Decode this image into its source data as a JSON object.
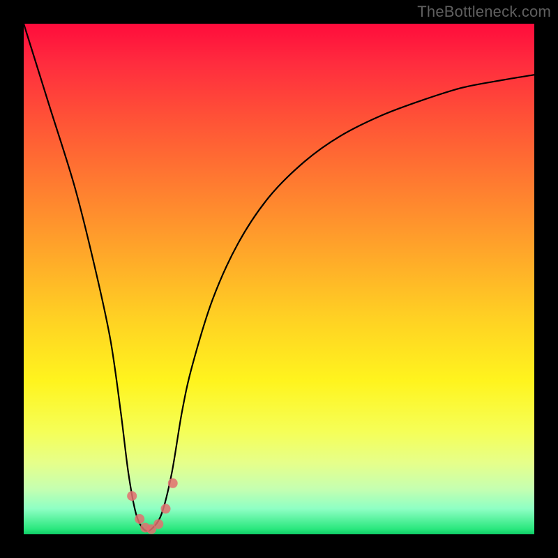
{
  "watermark": "TheBottleneck.com",
  "chart_data": {
    "type": "line",
    "title": "",
    "xlabel": "",
    "ylabel": "",
    "xlim": [
      0,
      100
    ],
    "ylim": [
      0,
      100
    ],
    "curve": {
      "x": [
        0,
        5,
        10,
        14,
        17,
        19,
        20.5,
        22,
        23.5,
        25,
        27,
        29,
        31,
        33,
        37,
        42,
        48,
        55,
        62,
        70,
        78,
        86,
        94,
        100
      ],
      "y": [
        100,
        84,
        68,
        52,
        38,
        24,
        12,
        4,
        1,
        1,
        4,
        12,
        24,
        33,
        46,
        57,
        66,
        73,
        78,
        82,
        85,
        87.5,
        89,
        90
      ]
    },
    "markers": {
      "x": [
        21.2,
        22.7,
        23.8,
        25.0,
        26.4,
        27.8,
        29.2
      ],
      "y": [
        7.5,
        3.0,
        1.3,
        1.0,
        2.0,
        5.0,
        10.0
      ]
    },
    "gradient_stops": [
      {
        "pct": 0,
        "color": "#ff0c3c"
      },
      {
        "pct": 8,
        "color": "#ff2d3e"
      },
      {
        "pct": 18,
        "color": "#ff5037"
      },
      {
        "pct": 30,
        "color": "#ff7731"
      },
      {
        "pct": 44,
        "color": "#ffa42a"
      },
      {
        "pct": 58,
        "color": "#ffd223"
      },
      {
        "pct": 70,
        "color": "#fff41e"
      },
      {
        "pct": 80,
        "color": "#f5ff58"
      },
      {
        "pct": 86,
        "color": "#e6ff8a"
      },
      {
        "pct": 91,
        "color": "#c6ffb0"
      },
      {
        "pct": 95,
        "color": "#8effc4"
      },
      {
        "pct": 99,
        "color": "#29e77d"
      },
      {
        "pct": 100,
        "color": "#0fcc66"
      }
    ],
    "background": "#000000"
  }
}
